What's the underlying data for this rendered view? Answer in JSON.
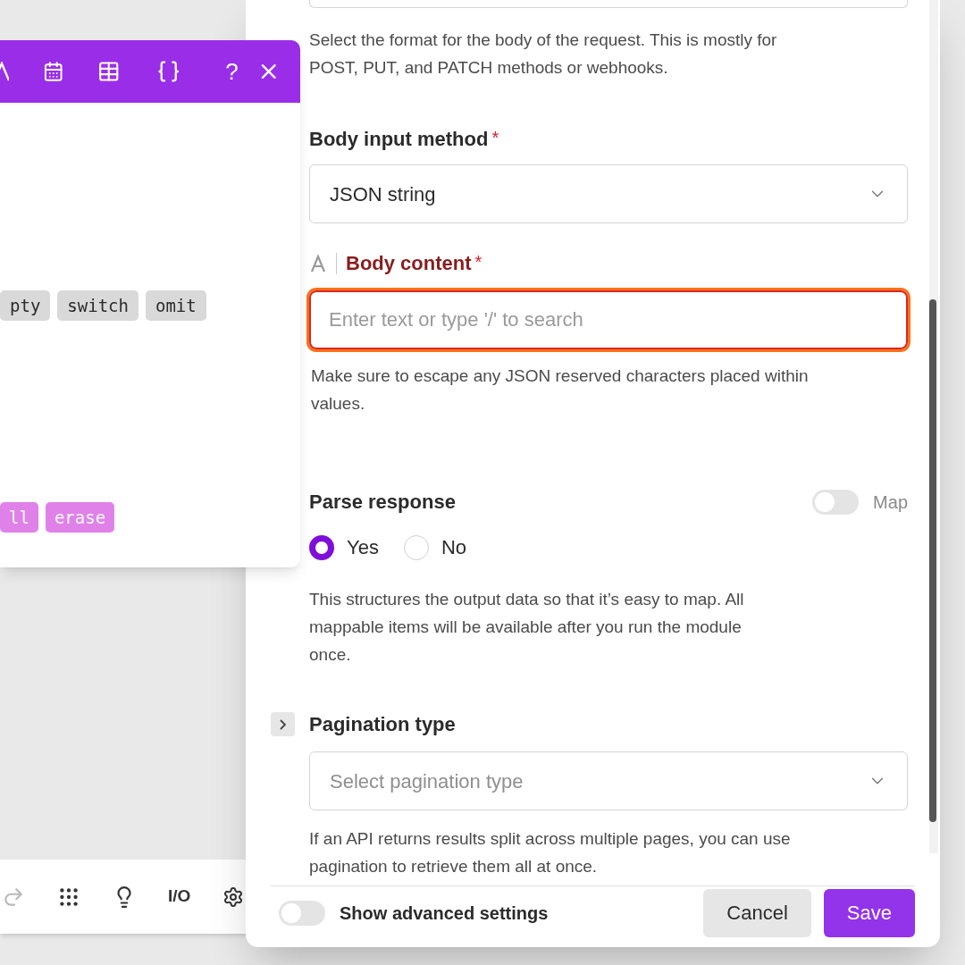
{
  "function_panel": {
    "help": "?",
    "general_tags": [
      "pty",
      "switch",
      "omit"
    ],
    "text_tags": [
      "ll",
      "erase"
    ]
  },
  "modal": {
    "format_hint": "Select the format for the body of the request. This is mostly for POST, PUT, and PATCH methods or webhooks.",
    "body_input_method": {
      "label": "Body input method",
      "required_mark": "*",
      "value": "JSON string"
    },
    "body_content": {
      "label": "Body content",
      "required_mark": "*",
      "placeholder": "Enter text or type '/' to search",
      "focused": true,
      "hint": "Make sure to escape any JSON reserved characters placed within values."
    },
    "parse_response": {
      "label": "Parse response",
      "map_toggle": {
        "label": "Map",
        "on": false
      },
      "options": [
        {
          "label": "Yes",
          "selected": true
        },
        {
          "label": "No",
          "selected": false
        }
      ],
      "hint": "This structures the output data so that it’s easy to map. All mappable items will be available after you run the module once."
    },
    "pagination": {
      "label": "Pagination type",
      "expanded": false,
      "placeholder": "Select pagination type",
      "hint": "If an API returns results split across multiple pages, you can use pagination to retrieve them all at once."
    },
    "footer": {
      "advanced_toggle": {
        "label": "Show advanced settings",
        "on": false
      },
      "buttons": [
        {
          "label": "Cancel",
          "kind": "secondary"
        },
        {
          "label": "Save",
          "kind": "primary"
        }
      ]
    }
  },
  "toolbar": {
    "io_label": "I/O"
  }
}
